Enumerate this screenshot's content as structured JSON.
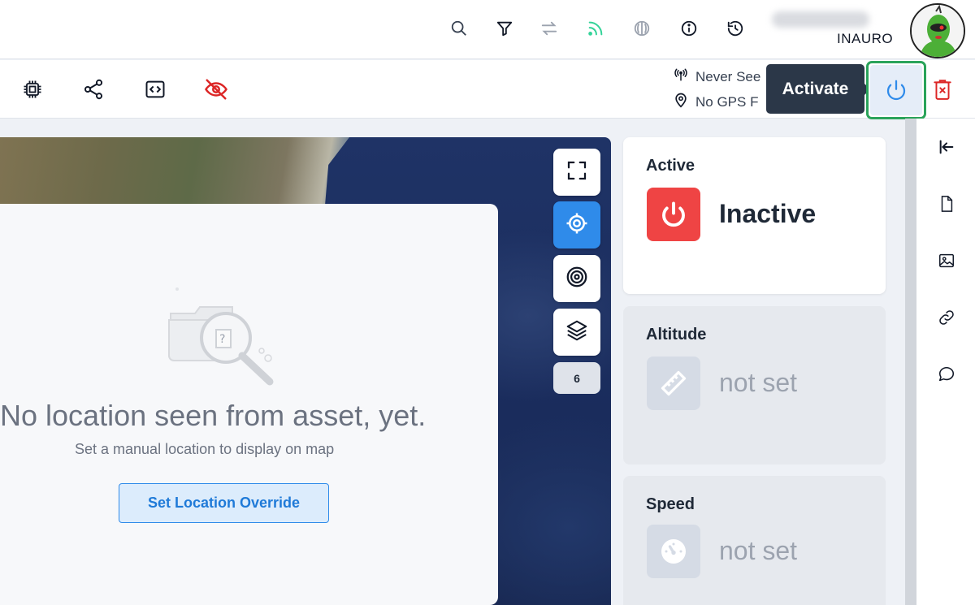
{
  "header": {
    "username": "INAURO",
    "icons": [
      "search-icon",
      "filter-icon",
      "transfer-icon",
      "feed-icon",
      "circle-half-icon",
      "info-icon",
      "history-icon"
    ],
    "accent_feed": "#34d399"
  },
  "toolbar": {
    "icons": [
      "chip-icon",
      "share-icon",
      "code-icon",
      "eye-off-icon"
    ],
    "status_seen": "Never See",
    "status_gps": "No GPS F",
    "tooltip": "Activate",
    "danger_color": "#dc2626",
    "highlight_color": "#2aa35a"
  },
  "map": {
    "controls": [
      "fullscreen-icon",
      "locate-icon",
      "target-icon",
      "layers-icon"
    ],
    "count": "6",
    "empty_title": "No location seen from asset, yet.",
    "empty_subtitle": "Set a manual location to display on map",
    "override_button": "Set Location Override"
  },
  "cards": {
    "active": {
      "title": "Active",
      "value": "Inactive",
      "icon": "power-icon",
      "color": "#ef4444"
    },
    "altitude": {
      "title": "Altitude",
      "value": "not set",
      "icon": "ruler-icon"
    },
    "speed": {
      "title": "Speed",
      "value": "not set",
      "icon": "gauge-icon"
    }
  },
  "sidebar": {
    "icons": [
      "collapse-left-icon",
      "document-icon",
      "image-icon",
      "link-icon",
      "chat-icon"
    ]
  }
}
